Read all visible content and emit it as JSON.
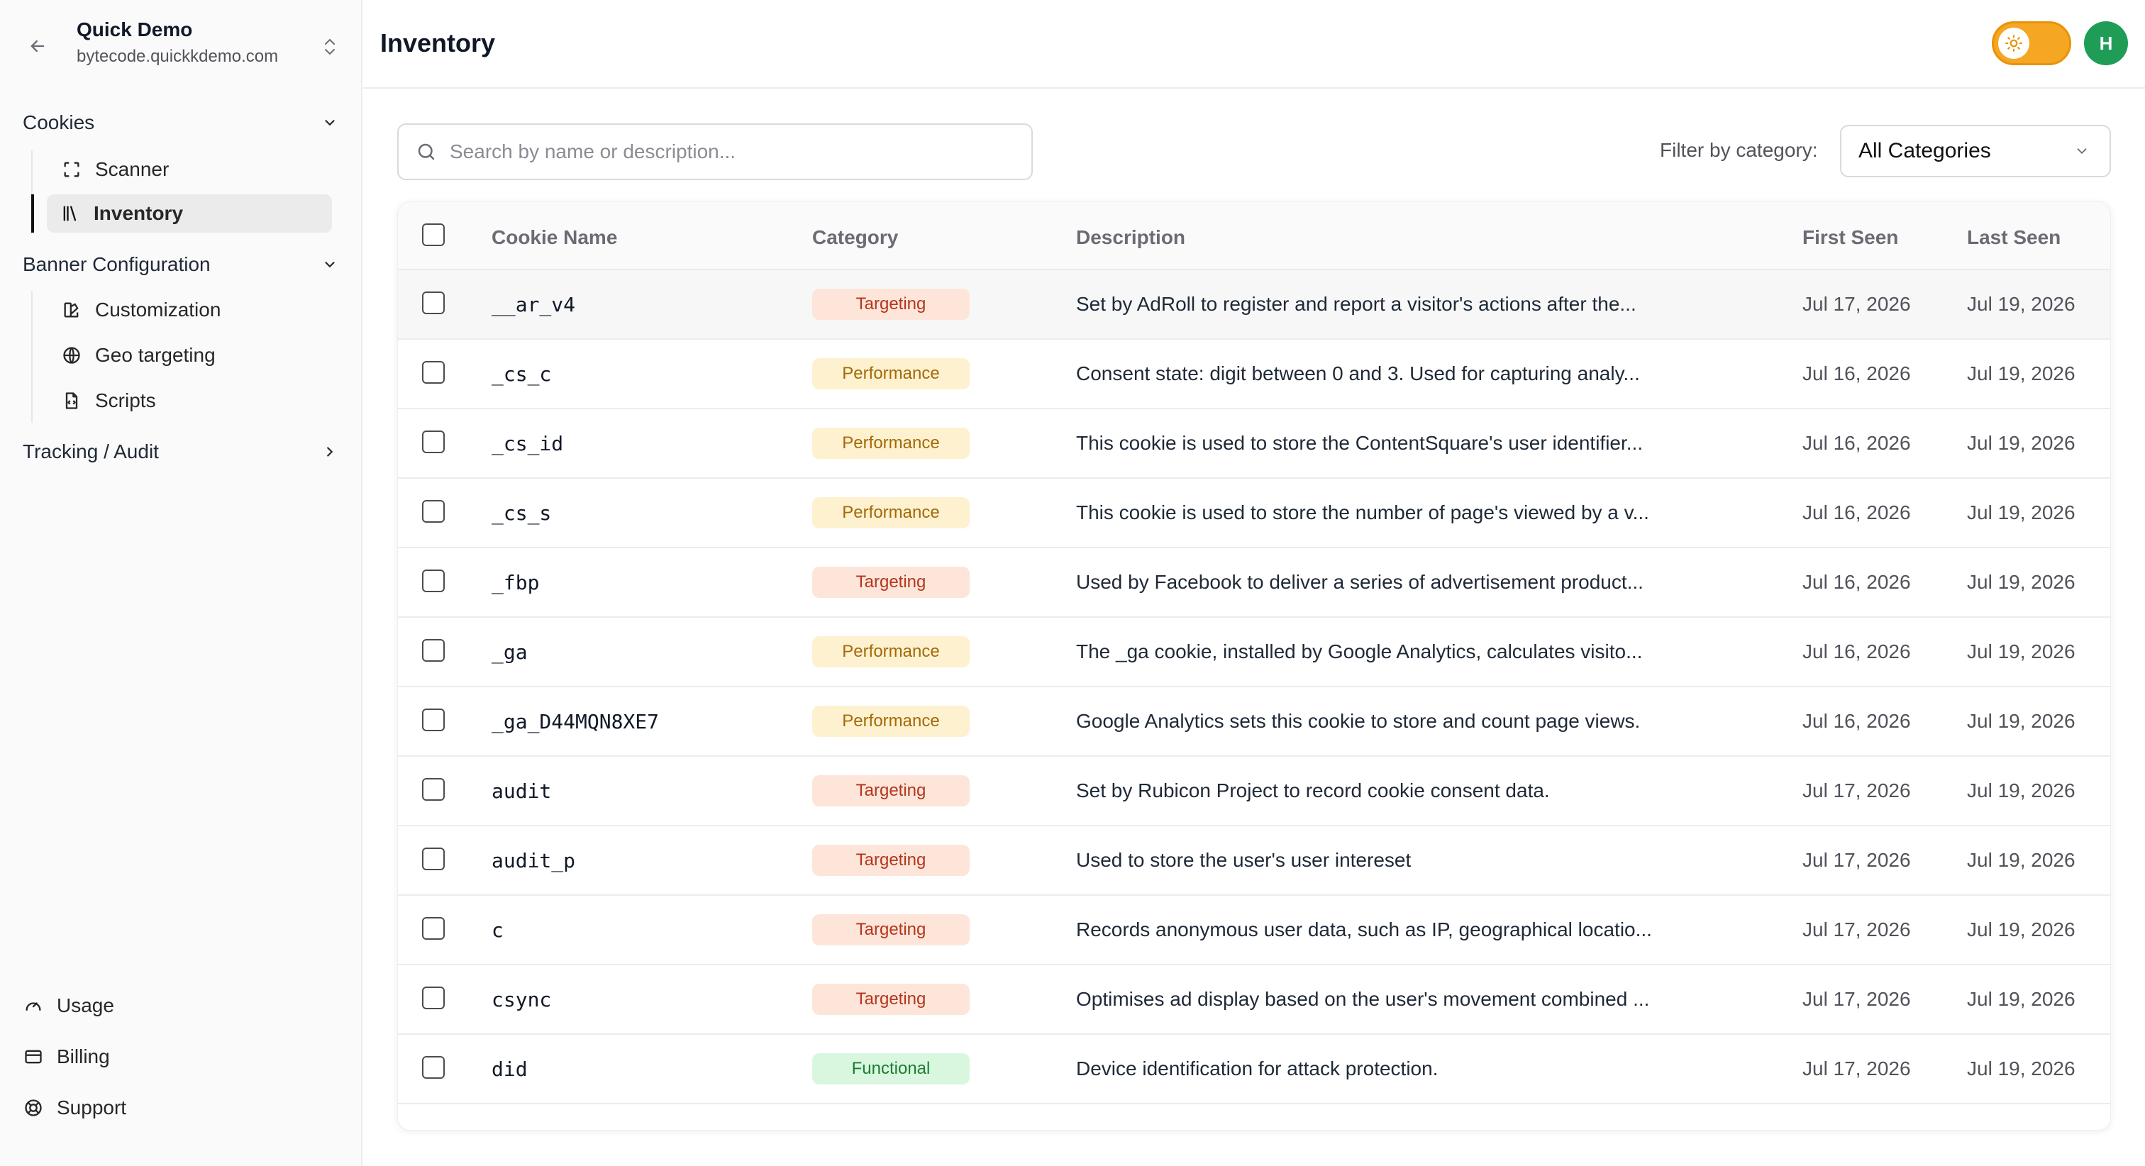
{
  "org": {
    "name": "Quick Demo",
    "domain": "bytecode.quickkdemo.com"
  },
  "nav": {
    "cookies_label": "Cookies",
    "cookies_items": [
      {
        "label": "Scanner",
        "icon": "scan-icon"
      },
      {
        "label": "Inventory",
        "icon": "library-icon"
      }
    ],
    "banner_label": "Banner Configuration",
    "banner_items": [
      {
        "label": "Customization",
        "icon": "palette-icon"
      },
      {
        "label": "Geo targeting",
        "icon": "globe-icon"
      },
      {
        "label": "Scripts",
        "icon": "file-code-icon"
      }
    ],
    "tracking_label": "Tracking / Audit",
    "bottom_items": [
      {
        "label": "Usage",
        "icon": "gauge-icon"
      },
      {
        "label": "Billing",
        "icon": "credit-card-icon"
      },
      {
        "label": "Support",
        "icon": "lifebuoy-icon"
      }
    ]
  },
  "header": {
    "title": "Inventory",
    "avatar_initial": "H"
  },
  "search": {
    "placeholder": "Search by name or description..."
  },
  "filter": {
    "label": "Filter by category:",
    "selected": "All Categories"
  },
  "table": {
    "columns": [
      "Cookie Name",
      "Category",
      "Description",
      "First Seen",
      "Last Seen"
    ],
    "rows": [
      {
        "name": "__ar_v4",
        "category": "Targeting",
        "description": "Set by AdRoll to register and report a visitor's actions after the...",
        "first_seen": "Jul 17, 2026",
        "last_seen": "Jul 19, 2026"
      },
      {
        "name": "_cs_c",
        "category": "Performance",
        "description": "Consent state: digit between 0 and 3. Used for capturing analy...",
        "first_seen": "Jul 16, 2026",
        "last_seen": "Jul 19, 2026"
      },
      {
        "name": "_cs_id",
        "category": "Performance",
        "description": "This cookie is used to store the ContentSquare's user identifier...",
        "first_seen": "Jul 16, 2026",
        "last_seen": "Jul 19, 2026"
      },
      {
        "name": "_cs_s",
        "category": "Performance",
        "description": "This cookie is used to store the number of page's viewed by a v...",
        "first_seen": "Jul 16, 2026",
        "last_seen": "Jul 19, 2026"
      },
      {
        "name": "_fbp",
        "category": "Targeting",
        "description": "Used by Facebook to deliver a series of advertisement product...",
        "first_seen": "Jul 16, 2026",
        "last_seen": "Jul 19, 2026"
      },
      {
        "name": "_ga",
        "category": "Performance",
        "description": "The _ga cookie, installed by Google Analytics, calculates visito...",
        "first_seen": "Jul 16, 2026",
        "last_seen": "Jul 19, 2026"
      },
      {
        "name": "_ga_D44MQN8XE7",
        "category": "Performance",
        "description": "Google Analytics sets this cookie to store and count page views.",
        "first_seen": "Jul 16, 2026",
        "last_seen": "Jul 19, 2026"
      },
      {
        "name": "audit",
        "category": "Targeting",
        "description": "Set by Rubicon Project to record cookie consent data.",
        "first_seen": "Jul 17, 2026",
        "last_seen": "Jul 19, 2026"
      },
      {
        "name": "audit_p",
        "category": "Targeting",
        "description": "Used to store the user's user intereset",
        "first_seen": "Jul 17, 2026",
        "last_seen": "Jul 19, 2026"
      },
      {
        "name": "c",
        "category": "Targeting",
        "description": "Records anonymous user data, such as IP, geographical locatio...",
        "first_seen": "Jul 17, 2026",
        "last_seen": "Jul 19, 2026"
      },
      {
        "name": "csync",
        "category": "Targeting",
        "description": "Optimises ad display based on the user's movement combined ...",
        "first_seen": "Jul 17, 2026",
        "last_seen": "Jul 19, 2026"
      },
      {
        "name": "did",
        "category": "Functional",
        "description": "Device identification for attack protection.",
        "first_seen": "Jul 17, 2026",
        "last_seen": "Jul 19, 2026"
      }
    ]
  }
}
